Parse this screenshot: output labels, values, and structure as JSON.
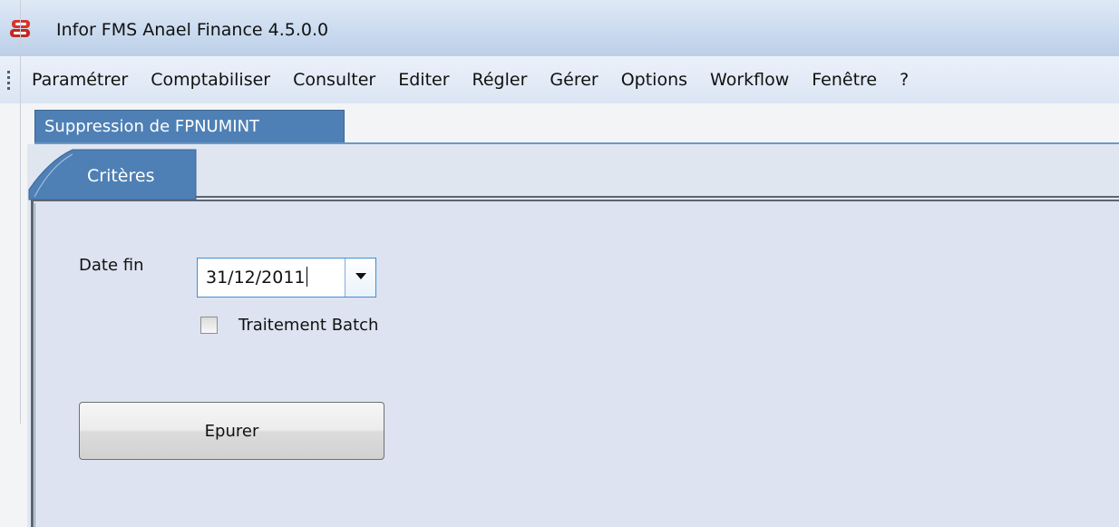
{
  "window": {
    "title": "Infor FMS Anael Finance 4.5.0.0",
    "app_icon": "anael-logo-icon"
  },
  "menu": {
    "items": [
      "Paramétrer",
      "Comptabiliser",
      "Consulter",
      "Editer",
      "Régler",
      "Gérer",
      "Options",
      "Workflow",
      "Fenêtre",
      "?"
    ]
  },
  "document_tab": {
    "label": "Suppression de FPNUMINT"
  },
  "inner_tab": {
    "label": "Critères"
  },
  "form": {
    "date_fin_label": "Date fin",
    "date_fin_value": "31/12/2011",
    "batch_label": "Traitement Batch",
    "batch_checked": false,
    "submit_label": "Epurer"
  },
  "colors": {
    "accent": "#4e80b5",
    "titlebar": "#cbdbef",
    "panel": "#dde3f0",
    "logo_red": "#d9342b"
  }
}
